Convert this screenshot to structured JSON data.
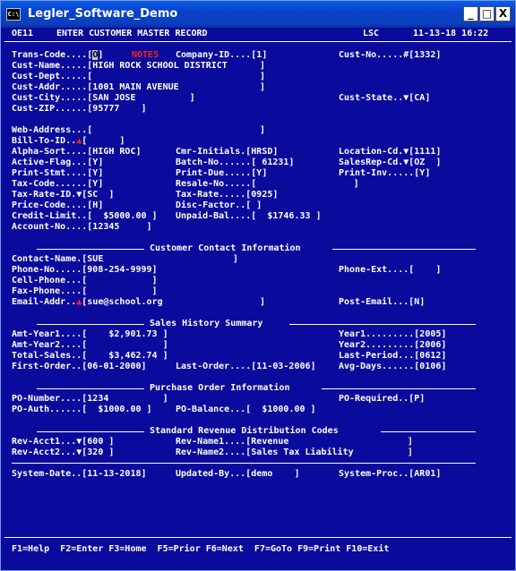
{
  "window": {
    "title": "Legler_Software_Demo",
    "icon": "C:\\",
    "min": "_",
    "max": "□",
    "close": "X"
  },
  "header": {
    "program": "OE11",
    "screen_title": "ENTER CUSTOMER MASTER RECORD",
    "user": "LSC",
    "date_time": "11-13-18 16:22"
  },
  "top": {
    "trans_code": "Trans-Code....[",
    "trans_code_val": "O",
    "trans_code_end": "]",
    "notes": "NOTES",
    "company": "Company-ID....[1]",
    "cust_no": "Cust-No.....#[1332]",
    "cust_name": "Cust-Name.....[HIGH ROCK SCHOOL DISTRICT      ]",
    "cust_dept": "Cust-Dept.....[                               ]",
    "cust_addr": "Cust-Addr.....[1001 MAIN AVENUE               ]",
    "cust_city": "Cust-City.....[SAN JOSE          ]",
    "cust_state": "Cust-State..▼[CA]",
    "cust_zip": "Cust-ZIP......[95777    ]"
  },
  "details": {
    "web": "Web-Address...[                               ]",
    "bill_to_a": "Bill-To-ID..",
    "bill_to_b": "[      ]",
    "alpha": "Alpha-Sort....[HIGH ROC]",
    "cmr": "Cmr-Initials.[HRSD]",
    "loc": "Location-Cd.▼[1111]",
    "active": "Active-Flag...[Y]",
    "batch": "Batch-No......[ 61231]",
    "salesrep": "SalesRep-Cd.▼[OZ  ]",
    "stmt": "Print-Stmt....[Y]",
    "due": "Print-Due.....[Y]",
    "inv": "Print-Inv.....[Y]",
    "taxcode": "Tax-Code......[Y]",
    "resale": "Resale-No.....[                  ]",
    "taxrateid": "Tax-Rate-ID.▼[SC  ]",
    "taxrate": "Tax-Rate.....[0925]",
    "price": "Price-Code....[H]",
    "disc": "Disc-Factor..[ ]",
    "credit": "Credit-Limit..[  $5000.00 ]",
    "unpaid": "Unpaid-Bal....[  $1746.33 ]",
    "account": "Account-No....[12345     ]"
  },
  "contact": {
    "section": "Customer Contact Information",
    "name": "Contact-Name.[SUE                        ]",
    "phone": "Phone-No.....[908-254-9999]",
    "phone_ext": "Phone-Ext....[    ]",
    "cell": "Cell-Phone...[            ]",
    "fax": "Fax-Phone....[            ]",
    "email_a": "Email-Addr..",
    "email_b": "[sue@school.org                  ]",
    "post_email": "Post-Email...[N]"
  },
  "sales": {
    "section": "Sales History Summary",
    "amt1": "Amt-Year1....[    $2,901.73 ]",
    "year1": "Year1.........[2005]",
    "amt2": "Amt-Year2....[              ]",
    "year2": "Year2.........[2006]",
    "total": "Total-Sales..[    $3,462.74 ]",
    "last_period": "Last-Period...[0612]",
    "first": "First-Order..[06-01-2000]",
    "last": "Last-Order....[11-03-2006]",
    "avg": "Avg-Days......[0106]"
  },
  "po": {
    "section": "Purchase Order Information",
    "number": "PO-Number....[1234          ]",
    "required": "PO-Required..[P]",
    "auth": "PO-Auth......[  $1000.00 ]",
    "balance": "PO-Balance...[  $1000.00 ]"
  },
  "rev": {
    "section": "Standard Revenue Distribution Codes",
    "acct1": "Rev-Acct1...▼[600 ]",
    "name1": "Rev-Name1....[Revenue                      ]",
    "acct2": "Rev-Acct2...▼[320 ]",
    "name2": "Rev-Name2....[Sales Tax Liability          ]"
  },
  "system": {
    "date": "System-Date..[11-13-2018]",
    "updated": "Updated-By...[demo    ]",
    "proc": "System-Proc..[AR01]"
  },
  "fkeys": "F1=Help  F2=Enter F3=Home  F5=Prior F6=Next  F7=GoTo F9=Print F10=Exit",
  "colors": {
    "background": "#0a0a9c",
    "text": "#ffffff",
    "accent": "#ff2020"
  }
}
